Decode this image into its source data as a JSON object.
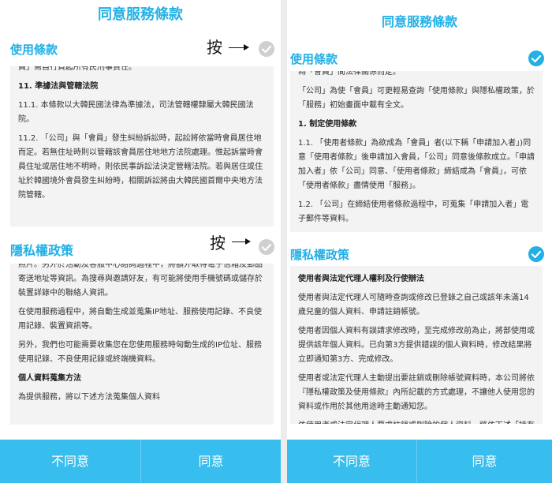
{
  "left": {
    "title": "同意服務條款",
    "terms": {
      "label": "使用條款",
      "paragraphs": [
        {
          "text": "員」需自行負起所有民刑事責任。",
          "heading": false
        },
        {
          "text": "11. 準據法與管轄法院",
          "heading": true
        },
        {
          "text": "11.1. 本條款以大韓民國法律為準據法，司法管轄權隸屬大韓民國法院。",
          "heading": false
        },
        {
          "text": "11.2. 「公司」與「會員」發生糾紛訴訟時，起訟將依當時會員居住地而定。若無住址時則以管轄該會員居住地地方法院處理。惟起訴當時會員住址或居住地不明時，則依民事訴訟法決定管轄法院。若與居住或住址於韓國境外會員發生糾紛時，相關訴訟將由大韓民國首爾中央地方法院管轄。",
          "heading": false
        }
      ]
    },
    "privacy": {
      "label": "隱私權政策",
      "paragraphs": [
        {
          "text": "照片。另外於活動及客服中心諮詢過程中，將額外取得電子信箱及郵品寄送地址等資訊。為搜尋與邀請好友，有可能將使用手機號碼或儲存於裝置詳錄中的聯絡人資訊。",
          "heading": false
        },
        {
          "text": "在使用服務過程中，將自動生成並蒐集IP地址、服務使用記錄、不良使用記錄、裝置資訊等。",
          "heading": false
        },
        {
          "text": "另外，我們也可能需要收集您在您使用服務時匈動生成的IP位址、服務使用記錄、不良使用記錄或終端機資料。",
          "heading": false
        },
        {
          "text": "個人資料蒐集方法",
          "heading": true
        },
        {
          "text": "為提供服務，將以下述方法蒐集個人資料",
          "heading": false
        }
      ]
    },
    "annotation_text": "按",
    "buttons": {
      "disagree": "不同意",
      "agree": "同意"
    }
  },
  "right": {
    "title": "同意服務條款",
    "terms": {
      "label": "使用條款",
      "paragraphs": [
        {
          "text": "為「會員」間法律關係而定。",
          "heading": false
        },
        {
          "text": "「公司」為使「會員」可更輕易查詢「使用條款」與隱私權政策，於「服務」初始畫面中載有全文。",
          "heading": false
        },
        {
          "text": "1. 制定使用條款",
          "heading": true
        },
        {
          "text": "1.1. 「使用者條款」為欲成為「會員」者(以下稱「申請加入者」)同意「使用者條款」後申請加入會員，「公司」同意後條款成立。「申請加入者」依「公司」同意、「使用者條款」締結成為「會員」，可依「使用者條款」盡情使用「服務」。",
          "heading": false
        },
        {
          "text": "1.2. 「公司」在締結使用者條款過程中，可蒐集「申請加入者」電子郵件等資料。",
          "heading": false
        }
      ]
    },
    "privacy": {
      "label": "隱私權政策",
      "paragraphs": [
        {
          "text": "使用者與法定代理人權利及行使辦法",
          "heading": true
        },
        {
          "text": "使用者與法定代理人可隨時查詢或修改已登錄之自己或該年未滿14歲兒童的個人資料、申請註銷帳號。",
          "heading": false
        },
        {
          "text": "使用者因個人資料有誤請求修改時，至完成修改前為止，將部使用或提供該年個人資料。已向第3方提供錯誤的個人資料時，修改結果將立即通知第3方、完成修改。",
          "heading": false
        },
        {
          "text": "使用者或法定代理人主動提出要註銷或刪除帳號資料時，本公司將依『隱私權政策及使用條款』內所記載的方式處理，不讓他人使用您的資料或作用於其他用途時主動通知您。",
          "heading": false
        },
        {
          "text": "依使用者或法定代理人要求註銷或刪除的個人資料，將依下述「持有個人資料及使用期間」範圍處理",
          "heading": false
        }
      ]
    },
    "buttons": {
      "disagree": "不同意",
      "agree": "同意"
    }
  },
  "colors": {
    "accent": "#22b0e6",
    "button": "#37bdee",
    "check_grey": "#cfcfcf",
    "box_bg": "#f3f3f3"
  },
  "icons": {
    "checked": "check-circle-icon",
    "unchecked": "check-circle-grey-icon"
  }
}
